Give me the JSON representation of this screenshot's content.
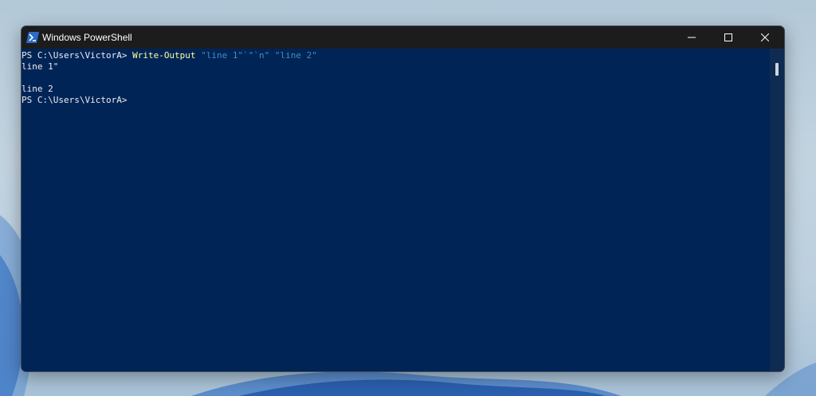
{
  "window": {
    "title": "Windows PowerShell",
    "app_icon": "powershell-icon",
    "controls": [
      "minimize-icon",
      "maximize-icon",
      "close-icon"
    ]
  },
  "console": {
    "prompt": "PS C:\\Users\\VictorA> ",
    "command": "Write-Output",
    "argument": " \"line 1\"`\"`n\" \"line 2\"",
    "output": [
      "line 1\"",
      "",
      "line 2"
    ],
    "final_prompt": "PS C:\\Users\\VictorA>"
  },
  "colors": {
    "console_background": "#012456",
    "titlebar": "#1c1c1c",
    "command": "#ffff9e",
    "string": "#3f8fbf",
    "text": "#eeedf0"
  }
}
